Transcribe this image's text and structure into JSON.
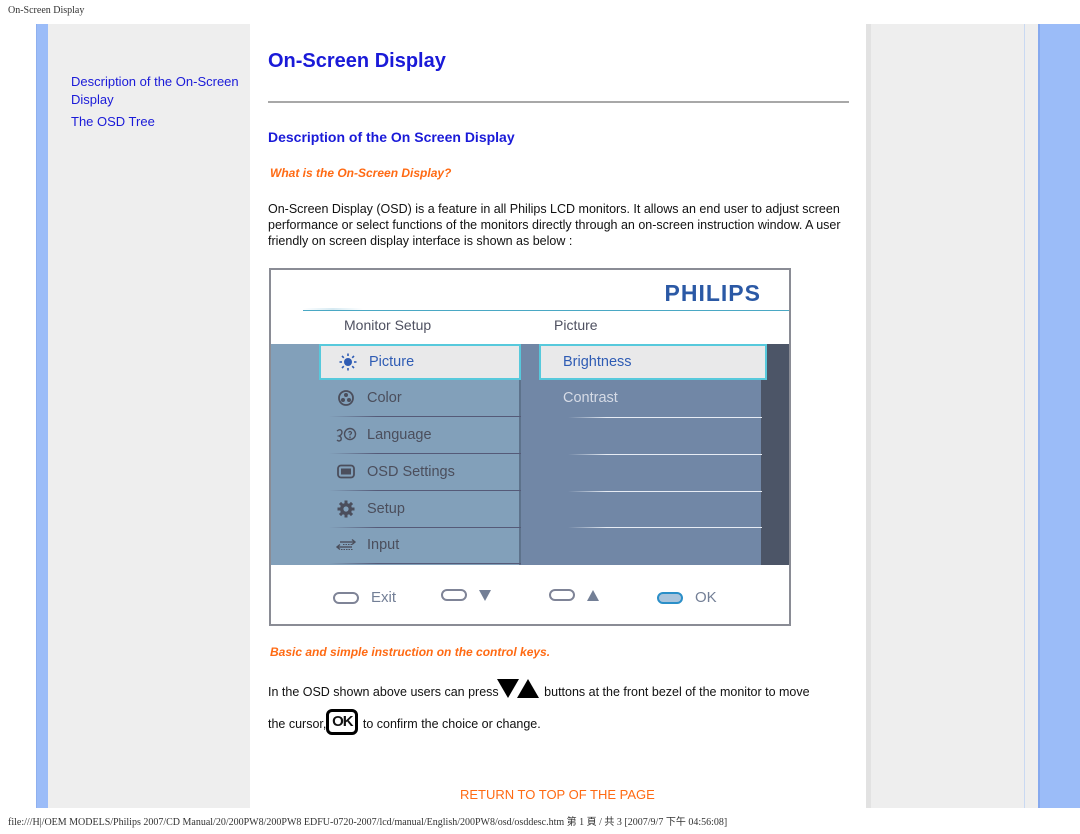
{
  "print_header": "On-Screen Display",
  "sidebar": {
    "links": [
      {
        "label": "Description of the On-Screen Display"
      },
      {
        "label": "The OSD Tree"
      }
    ]
  },
  "main": {
    "title": "On-Screen Display",
    "section_title": "Description of the On Screen Display",
    "subhead_1": "What is the On-Screen Display?",
    "paragraph": "On-Screen Display (OSD) is a feature in all Philips LCD monitors. It allows an end user to adjust screen performance or select functions of the monitors directly through an on-screen instruction window. A user friendly on screen display interface is shown as below :",
    "subhead_2": "Basic and simple instruction on the control keys.",
    "instruction": {
      "line1_before": "In the OSD shown above users can press",
      "line1_after": " buttons at the front bezel of the monitor to move",
      "line2_before": "the cursor,",
      "ok_key": "OK",
      "line2_after": " to confirm the choice or change."
    },
    "return_link": "RETURN TO TOP OF THE PAGE"
  },
  "osd": {
    "brand": "PHILIPS",
    "header_left": "Monitor Setup",
    "header_right": "Picture",
    "menu": [
      {
        "label": "Picture",
        "icon": "sun-icon",
        "selected": true
      },
      {
        "label": "Color",
        "icon": "color-wheel-icon",
        "selected": false
      },
      {
        "label": "Language",
        "icon": "language-icon",
        "selected": false
      },
      {
        "label": "OSD Settings",
        "icon": "monitor-icon",
        "selected": false
      },
      {
        "label": "Setup",
        "icon": "gear-icon",
        "selected": false
      },
      {
        "label": "Input",
        "icon": "input-arrows-icon",
        "selected": false
      }
    ],
    "submenu": [
      {
        "label": "Brightness",
        "selected": true
      },
      {
        "label": "Contrast",
        "selected": false
      }
    ],
    "keys": [
      {
        "label": "Exit"
      },
      {
        "label": "▼"
      },
      {
        "label": "▲"
      },
      {
        "label": "OK"
      }
    ],
    "colors": {
      "selection_border": "#57c9dc",
      "selected_text": "#2f5cb4",
      "brand": "#2b59a5"
    }
  },
  "colors": {
    "link_blue": "#1a1ad8",
    "accent_orange": "#ff6a13",
    "side_stripe": "#9bbcf8"
  },
  "print_footer": "file:///H|/OEM MODELS/Philips 2007/CD Manual/20/200PW8/200PW8 EDFU-0720-2007/lcd/manual/English/200PW8/osd/osddesc.htm 第 1 頁 / 共 3 [2007/9/7 下午 04:56:08]"
}
